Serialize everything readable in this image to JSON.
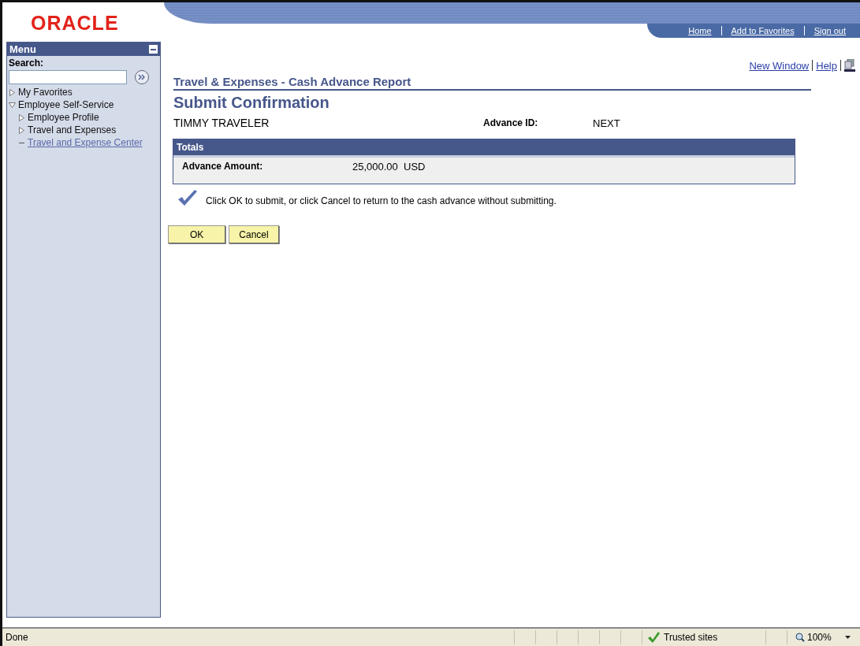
{
  "header": {
    "logo": "ORACLE",
    "links": [
      "Home",
      "Add to Favorites",
      "Sign out"
    ]
  },
  "menu": {
    "title": "Menu",
    "search_label": "Search:",
    "items": [
      {
        "label": "My Favorites",
        "kind": "folder",
        "expanded": false
      },
      {
        "label": "Employee Self-Service",
        "kind": "folder",
        "expanded": true,
        "children": [
          {
            "label": "Employee Profile",
            "kind": "folder",
            "expanded": false
          },
          {
            "label": "Travel and Expenses",
            "kind": "folder",
            "expanded": false
          },
          {
            "label": "Travel and Expense Center",
            "kind": "link"
          }
        ]
      }
    ]
  },
  "page_links": [
    "New Window",
    "Help"
  ],
  "breadcrumb": "Travel & Expenses - Cash Advance Report",
  "title": "Submit Confirmation",
  "employee": "TIMMY TRAVELER",
  "advance_id": {
    "label": "Advance ID:",
    "value": "NEXT"
  },
  "totals": {
    "title": "Totals",
    "label": "Advance Amount:",
    "amount": "25,000.00",
    "currency": "USD"
  },
  "message": "Click OK to submit, or click Cancel to return to the cash advance without submitting.",
  "buttons": [
    "OK",
    "Cancel"
  ],
  "status_bar": {
    "status": "Done",
    "zone": "Trusted sites",
    "zoom": "100%"
  }
}
